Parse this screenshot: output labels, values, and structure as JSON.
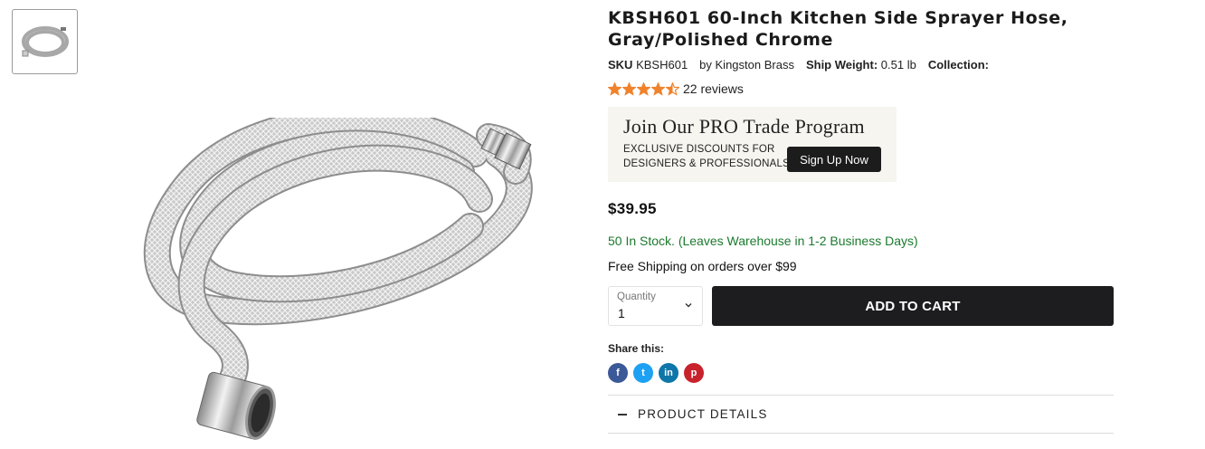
{
  "product": {
    "title_line1": "KBSH601 60-Inch Kitchen Side Sprayer Hose,",
    "title_line2": "Gray/Polished Chrome",
    "sku_label": "SKU",
    "sku_value": "KBSH601",
    "brand_text": "by Kingston Brass",
    "ship_weight_label": "Ship Weight:",
    "ship_weight_value": "0.51 lb",
    "collection_label": "Collection:",
    "rating": 4.5,
    "rating_max": 5,
    "reviews_text": "22 reviews",
    "price": "$39.95",
    "stock_text": "50 In Stock. (Leaves Warehouse in 1-2 Business Days)",
    "shipping_text": "Free Shipping on orders over $99"
  },
  "promo": {
    "title": "Join Our PRO Trade Program",
    "line1": "EXCLUSIVE DISCOUNTS FOR",
    "line2": "DESIGNERS & PROFESSIONALS",
    "button": "Sign Up Now"
  },
  "purchase": {
    "quantity_label": "Quantity",
    "quantity_value": "1",
    "add_to_cart": "ADD TO CART"
  },
  "share": {
    "label": "Share this:",
    "icons": [
      {
        "name": "facebook-icon",
        "glyph": "f",
        "color": "#3b5998"
      },
      {
        "name": "twitter-icon",
        "glyph": "t",
        "color": "#1da1f2"
      },
      {
        "name": "linkedin-icon",
        "glyph": "in",
        "color": "#0e76a8"
      },
      {
        "name": "pinterest-icon",
        "glyph": "p",
        "color": "#c8232c"
      }
    ]
  },
  "details": {
    "label": "PRODUCT DETAILS"
  },
  "colors": {
    "star": "#f0822c",
    "stock_green": "#1b7a2e",
    "button_dark": "#1d1d1f"
  }
}
